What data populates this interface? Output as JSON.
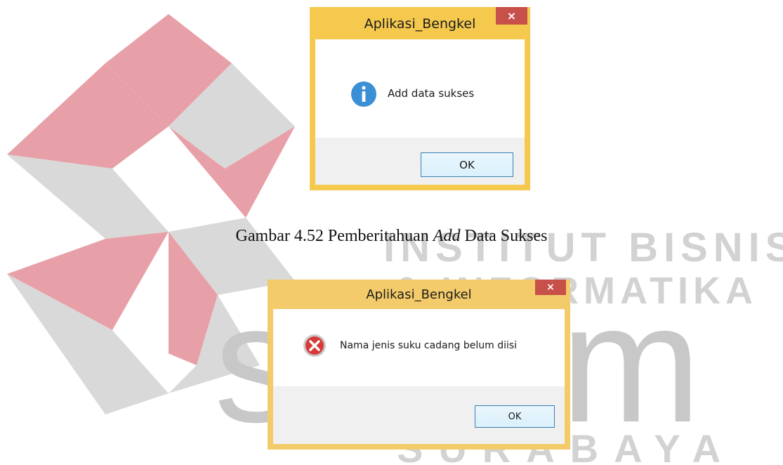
{
  "watermark": {
    "brand_line1": "INSTITUT BISNIS",
    "brand_line2": "& INFORMATIKA",
    "logo_text": "stikom",
    "city": "SURABAYA",
    "colors": {
      "diamond_red": "#e8a0a8",
      "diamond_gray": "#d9d9d9",
      "text_gray": "#d2d2d2"
    }
  },
  "dialog_info": {
    "title": "Aplikasi_Bengkel",
    "close_label": "×",
    "message": "Add data sukses",
    "ok_label": "OK",
    "icon": "info-icon"
  },
  "caption": {
    "prefix": "Gambar 4.52 Pemberitahuan ",
    "term": "Add",
    "suffix": " Data Sukses"
  },
  "dialog_error": {
    "title": "Aplikasi_Bengkel",
    "close_label": "×",
    "message": "Nama jenis suku cadang belum diisi",
    "ok_label": "OK",
    "icon": "error-icon"
  },
  "colors": {
    "frame_yellow": "#f5c94e",
    "close_red": "#c7504a",
    "info_blue": "#3b8fd4",
    "error_red": "#d83a3a"
  }
}
